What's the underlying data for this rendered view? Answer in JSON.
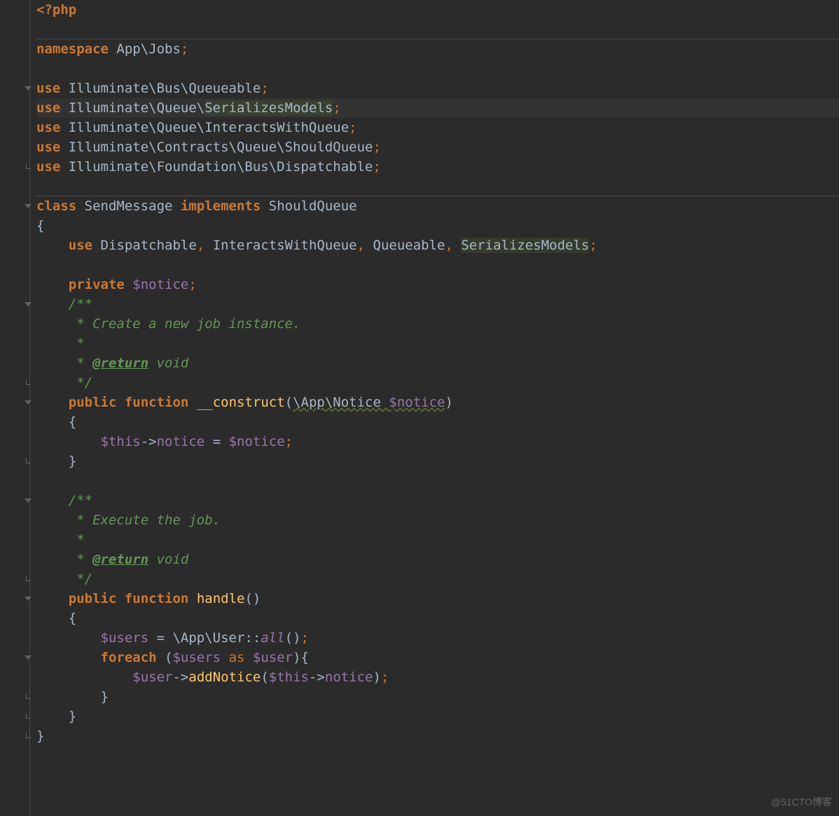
{
  "watermark": "@51CTO博客",
  "code": {
    "l1": {
      "open": "<?php"
    },
    "l3": {
      "kw": "namespace",
      "ns": " App\\Jobs",
      "semi": ";"
    },
    "l5": {
      "kw": "use",
      "ns": " Illuminate\\Bus\\Queueable",
      "semi": ";"
    },
    "l6": {
      "kw": "use",
      "ns": " Illuminate\\Queue\\",
      "hint": "SerializesModels",
      "semi": ";"
    },
    "l7": {
      "kw": "use",
      "ns": " Illuminate\\Queue\\InteractsWithQueue",
      "semi": ";"
    },
    "l8": {
      "kw": "use",
      "ns": " Illuminate\\Contracts\\Queue\\ShouldQueue",
      "semi": ";"
    },
    "l9": {
      "kw": "use",
      "ns": " Illuminate\\Foundation\\Bus\\Dispatchable",
      "semi": ";"
    },
    "l11": {
      "kw": "class",
      "name": " SendMessage ",
      "impl": "implements",
      "iface": " ShouldQueue"
    },
    "l12": {
      "brace": "{"
    },
    "l13": {
      "kw": "use",
      "t1": " Dispatchable",
      "c": ", ",
      "t2": "InteractsWithQueue",
      "t3": "Queueable",
      "t4": "SerializesModels",
      "semi": ";"
    },
    "l15": {
      "kw": "private",
      "var": " $notice",
      "semi": ";"
    },
    "l16": {
      "c": "/**"
    },
    "l17": {
      "c": " * Create a new job instance."
    },
    "l18": {
      "c": " *"
    },
    "l19": {
      "c1": " * ",
      "tag": "@return",
      "c2": " void"
    },
    "l20": {
      "c": " */"
    },
    "l21": {
      "kw1": "public",
      "kw2": "function",
      "fn": " __construct",
      "p1": "(",
      "type": "\\App\\Notice ",
      "var": "$notice",
      "p2": ")"
    },
    "l22": {
      "brace": "{"
    },
    "l23": {
      "v1": "$this",
      "arrow": "->",
      "prop": "notice",
      "eq": " = ",
      "v2": "$notice",
      "semi": ";"
    },
    "l24": {
      "brace": "}"
    },
    "l26": {
      "c": "/**"
    },
    "l27": {
      "c": " * Execute the job."
    },
    "l28": {
      "c": " *"
    },
    "l29": {
      "c1": " * ",
      "tag": "@return",
      "c2": " void"
    },
    "l30": {
      "c": " */"
    },
    "l31": {
      "kw1": "public",
      "kw2": "function",
      "fn": " handle",
      "p": "()"
    },
    "l32": {
      "brace": "{"
    },
    "l33": {
      "v": "$users",
      "eq": " = ",
      "ns": "\\App\\User",
      "dc": "::",
      "m": "all",
      "p": "()",
      "semi": ";"
    },
    "l34": {
      "kw": "foreach",
      "p1": " (",
      "v1": "$users",
      "as": " as ",
      "v2": "$user",
      "p2": ")",
      "brace": "{"
    },
    "l35": {
      "v": "$user",
      "arrow": "->",
      "m": "addNotice",
      "p1": "(",
      "v2": "$this",
      "arrow2": "->",
      "prop": "notice",
      "p2": ")",
      "semi": ";"
    },
    "l36": {
      "brace": "}"
    },
    "l37": {
      "brace": "}"
    },
    "l38": {
      "brace": "}"
    }
  }
}
